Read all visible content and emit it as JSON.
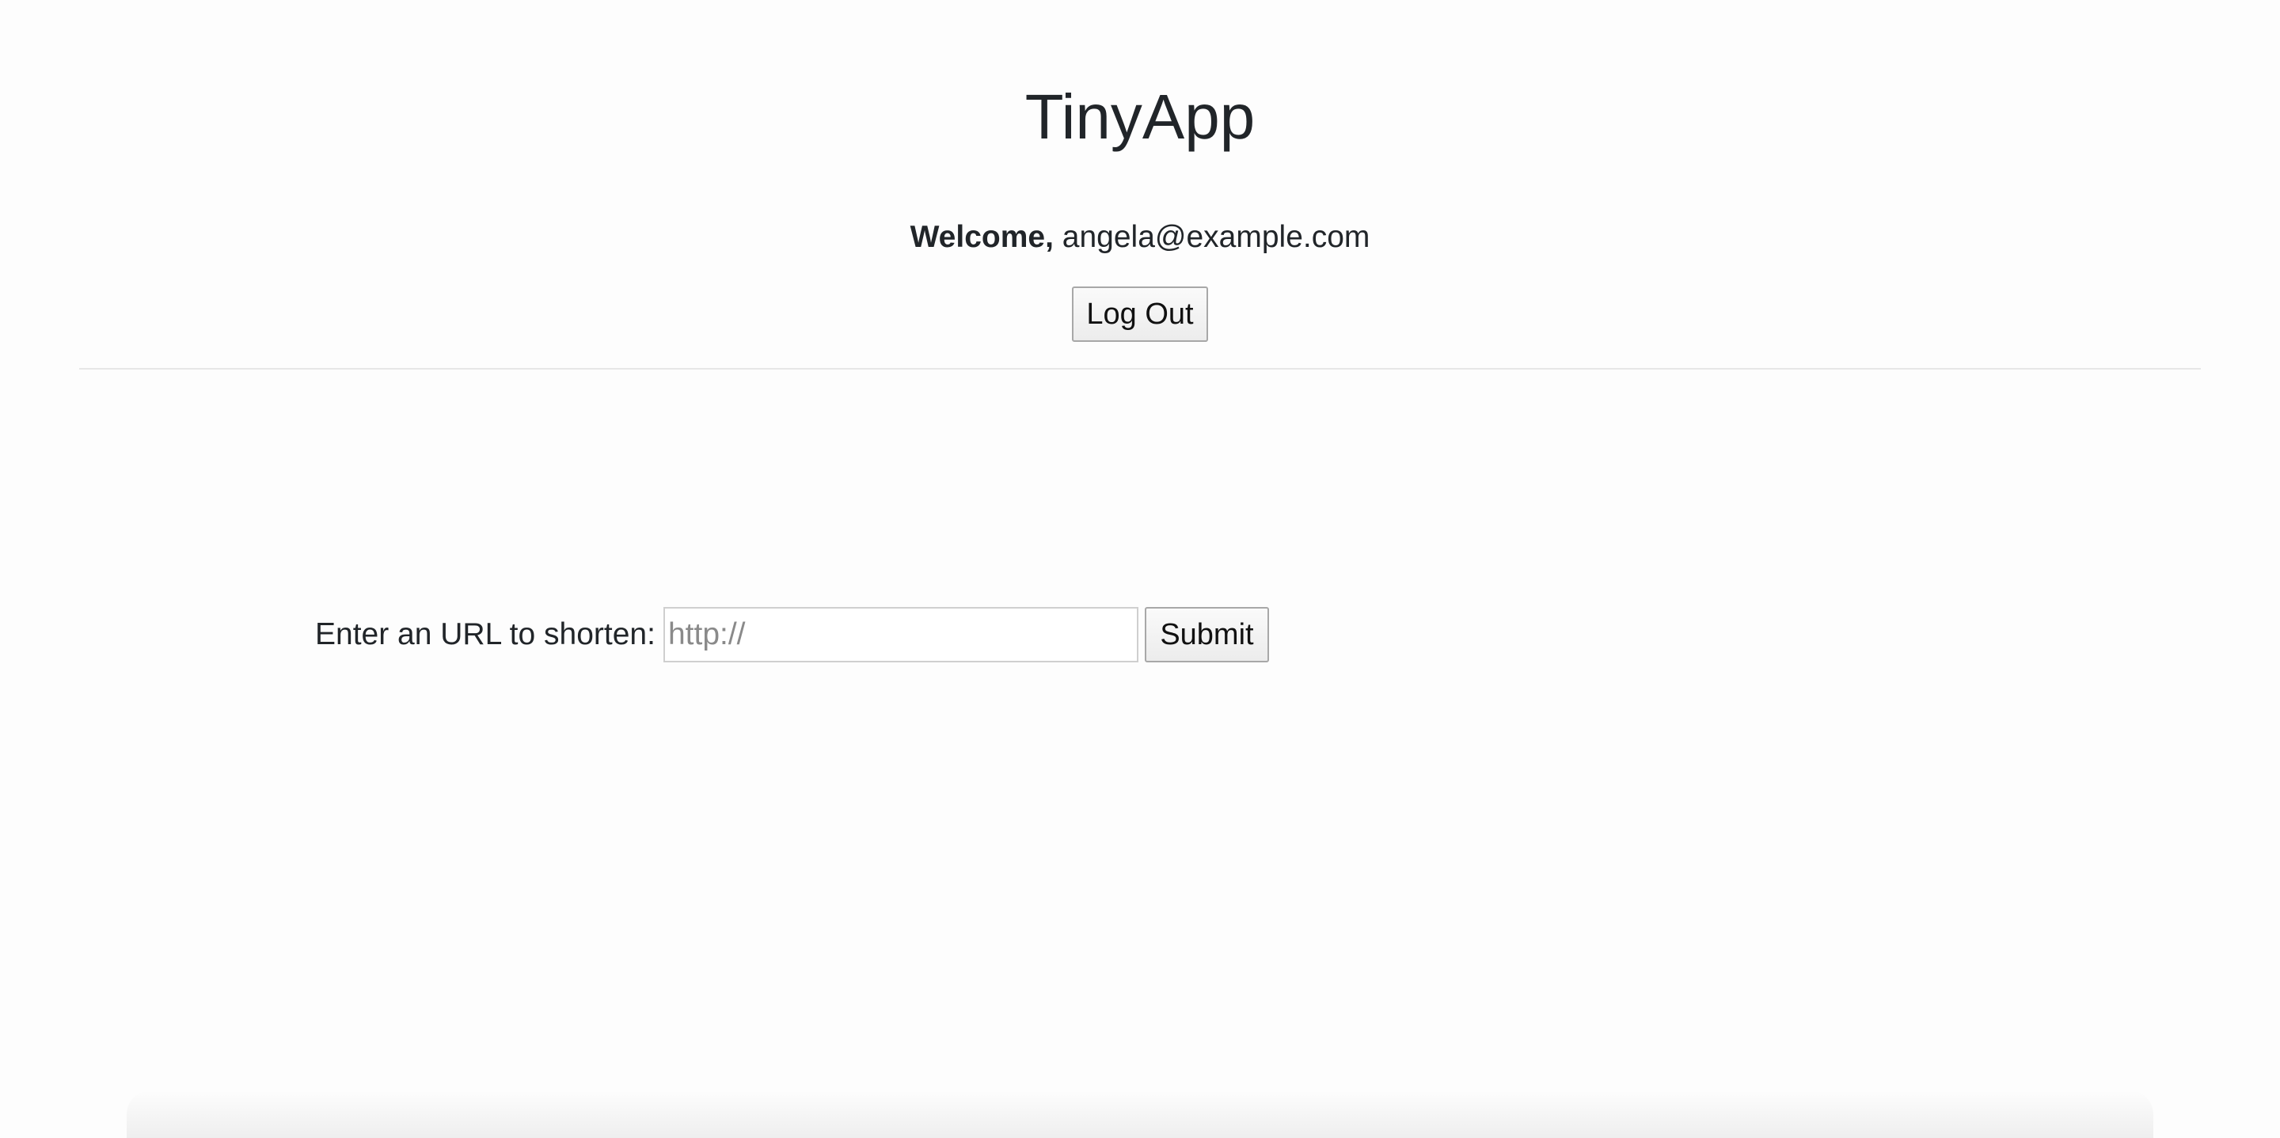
{
  "header": {
    "title": "TinyApp",
    "welcome_label": "Welcome,",
    "user_email": "angela@example.com",
    "logout_label": "Log Out"
  },
  "form": {
    "label": "Enter an URL to shorten:",
    "placeholder": "http://",
    "value": "",
    "submit_label": "Submit"
  }
}
